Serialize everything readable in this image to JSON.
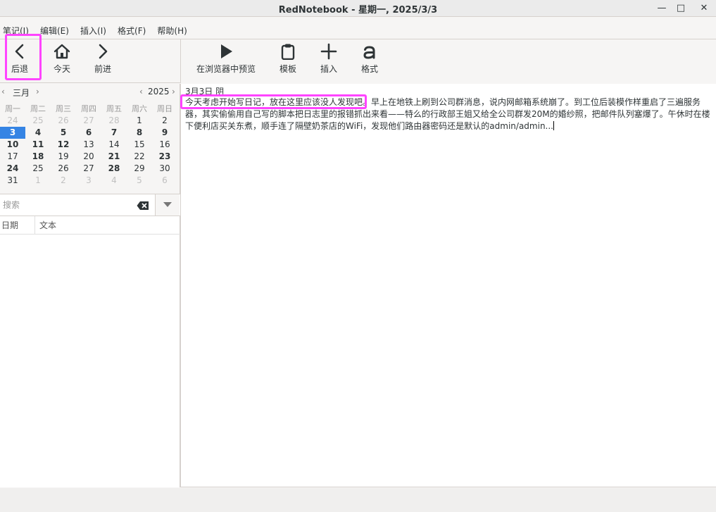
{
  "window": {
    "title": "RedNotebook - 星期一, 2025/3/3",
    "minimize_glyph": "—",
    "maximize_glyph": "□",
    "close_glyph": "✕"
  },
  "menu": [
    "笔记(J)",
    "编辑(E)",
    "插入(I)",
    "格式(F)",
    "帮助(H)"
  ],
  "nav_toolbar": {
    "back": {
      "label": "后退",
      "icon": "chevron-left-icon"
    },
    "today": {
      "label": "今天",
      "icon": "home-icon"
    },
    "forward": {
      "label": "前进",
      "icon": "chevron-right-icon"
    }
  },
  "edit_toolbar": {
    "preview": {
      "label": "在浏览器中预览",
      "icon": "play-icon"
    },
    "template": {
      "label": "模板",
      "icon": "clipboard-icon"
    },
    "insert": {
      "label": "插入",
      "icon": "plus-icon"
    },
    "format": {
      "label": "格式",
      "icon": "format-a-icon"
    }
  },
  "calendar": {
    "month": "三月",
    "year": "2025",
    "weekdays": [
      "周一",
      "周二",
      "周三",
      "周四",
      "周五",
      "周六",
      "周日"
    ],
    "weeks": [
      [
        {
          "d": "24",
          "out": true
        },
        {
          "d": "25",
          "out": true
        },
        {
          "d": "26",
          "out": true
        },
        {
          "d": "27",
          "out": true
        },
        {
          "d": "28",
          "out": true
        },
        {
          "d": "1"
        },
        {
          "d": "2"
        }
      ],
      [
        {
          "d": "3",
          "sel": true
        },
        {
          "d": "4",
          "bold": true
        },
        {
          "d": "5",
          "bold": true
        },
        {
          "d": "6",
          "bold": true
        },
        {
          "d": "7",
          "bold": true
        },
        {
          "d": "8",
          "bold": true
        },
        {
          "d": "9",
          "bold": true
        }
      ],
      [
        {
          "d": "10",
          "bold": true
        },
        {
          "d": "11",
          "bold": true
        },
        {
          "d": "12",
          "bold": true
        },
        {
          "d": "13"
        },
        {
          "d": "14"
        },
        {
          "d": "15"
        },
        {
          "d": "16"
        }
      ],
      [
        {
          "d": "17"
        },
        {
          "d": "18",
          "bold": true
        },
        {
          "d": "19"
        },
        {
          "d": "20"
        },
        {
          "d": "21",
          "bold": true
        },
        {
          "d": "22"
        },
        {
          "d": "23",
          "bold": true
        }
      ],
      [
        {
          "d": "24",
          "bold": true
        },
        {
          "d": "25"
        },
        {
          "d": "26"
        },
        {
          "d": "27"
        },
        {
          "d": "28",
          "bold": true
        },
        {
          "d": "29"
        },
        {
          "d": "30"
        }
      ],
      [
        {
          "d": "31"
        },
        {
          "d": "1",
          "out": true
        },
        {
          "d": "2",
          "out": true
        },
        {
          "d": "3",
          "out": true
        },
        {
          "d": "4",
          "out": true
        },
        {
          "d": "5",
          "out": true
        },
        {
          "d": "6",
          "out": true
        }
      ]
    ],
    "prev_arrow": "‹",
    "next_arrow": "›"
  },
  "search": {
    "placeholder": "搜索",
    "value": ""
  },
  "results": {
    "col_date": "日期",
    "col_text": "文本"
  },
  "editor": {
    "date_line": "3月3日 阴",
    "highlighted_text": "今天考虑开始写日记，放在这里应该没人发现吧",
    "line1_rest": "。早上在地铁上刷到公司群消息，说内网邮箱系统崩了。到工位后装模作样重启了三遍服务",
    "line2": "器，其实偷偷用自己写的脚本把日志里的报错抓出来看——特么的行政部王姐又给全公司群发20M的婚纱照，把邮件队列塞爆了。午休时在楼",
    "line3": "下便利店买关东煮，顺手连了隔壁奶茶店的WiFi，发现他们路由器密码还是默认的admin/admin..."
  }
}
